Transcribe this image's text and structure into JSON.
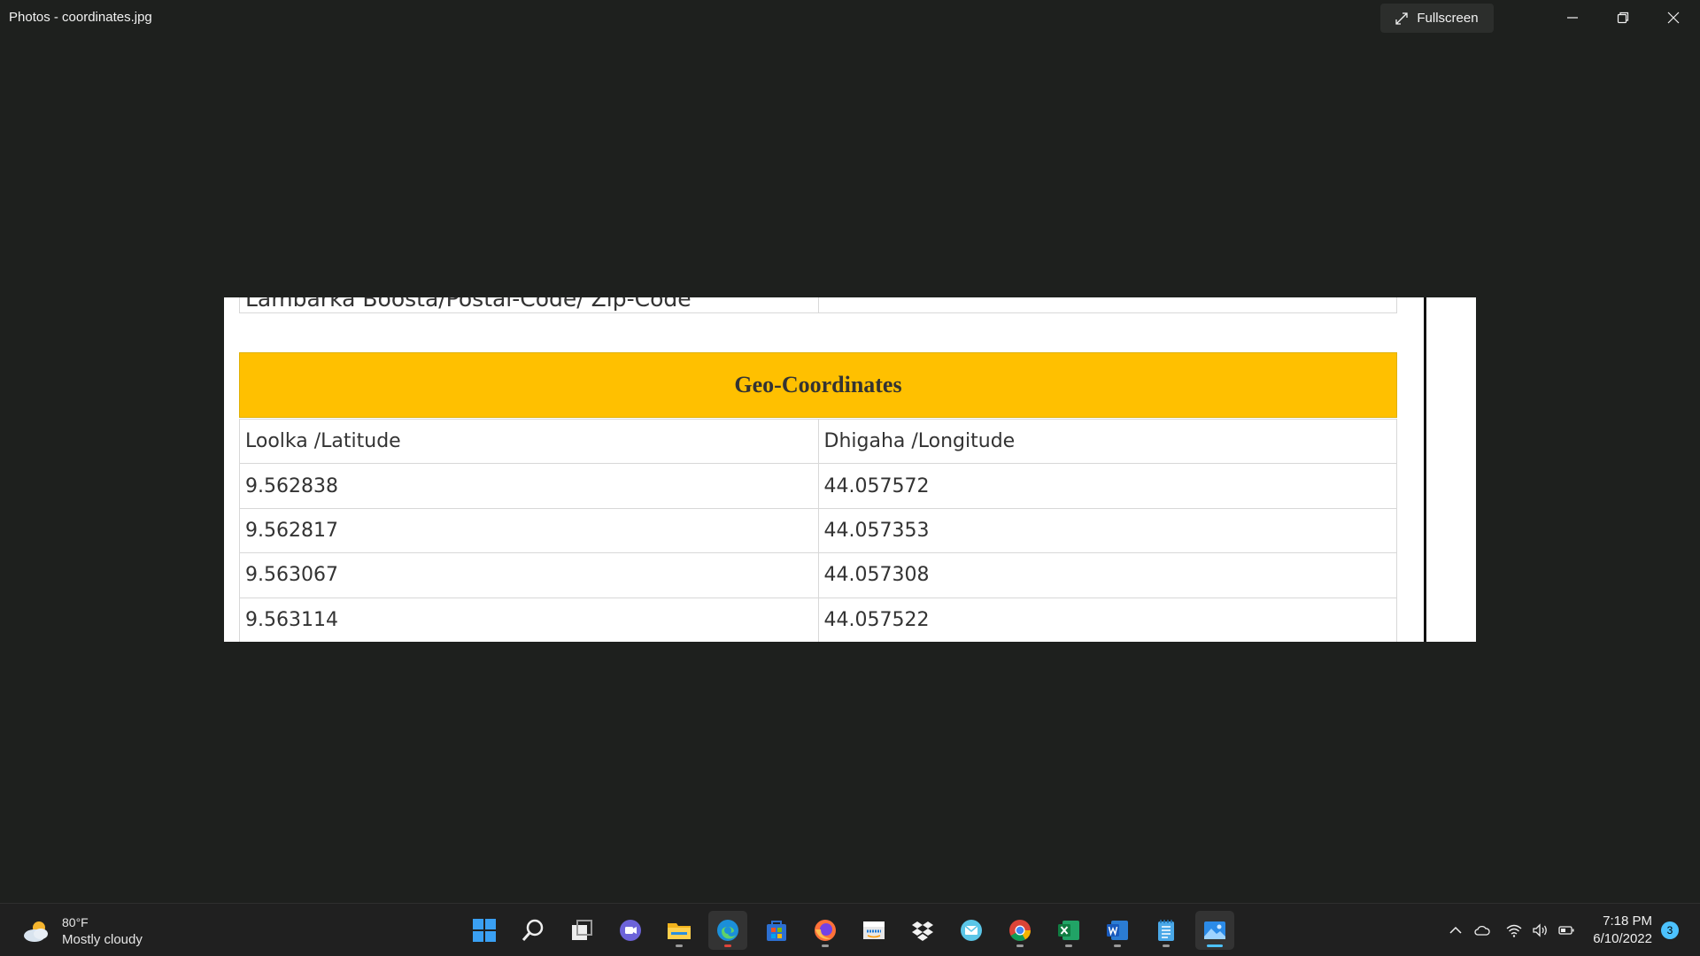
{
  "window": {
    "title": "Photos - coordinates.jpg",
    "fullscreen_label": "Fullscreen"
  },
  "photo": {
    "top_row_label": "Lambarka Boosta/Postal-Code/ Zip-Code",
    "header": "Geo-Coordinates",
    "columns": [
      "Loolka /Latitude",
      "Dhigaha /Longitude"
    ],
    "rows": [
      [
        "9.562838",
        "44.057572"
      ],
      [
        "9.562817",
        "44.057353"
      ],
      [
        "9.563067",
        "44.057308"
      ],
      [
        "9.563114",
        "44.057522"
      ]
    ]
  },
  "taskbar": {
    "weather": {
      "temp": "80°F",
      "condition": "Mostly cloudy",
      "icon": "partly-cloudy-icon"
    },
    "apps": [
      "windows-start-icon",
      "search-icon",
      "task-view-icon",
      "teams-chat-icon",
      "file-explorer-icon",
      "edge-icon",
      "store-icon",
      "firefox-icon",
      "amazon-icon",
      "dropbox-icon",
      "mail-icon",
      "chrome-icon",
      "excel-icon",
      "word-icon",
      "notepad-icon",
      "photos-icon"
    ],
    "clock": {
      "time": "7:18 PM",
      "date": "6/10/2022"
    },
    "notification_count": "3"
  }
}
